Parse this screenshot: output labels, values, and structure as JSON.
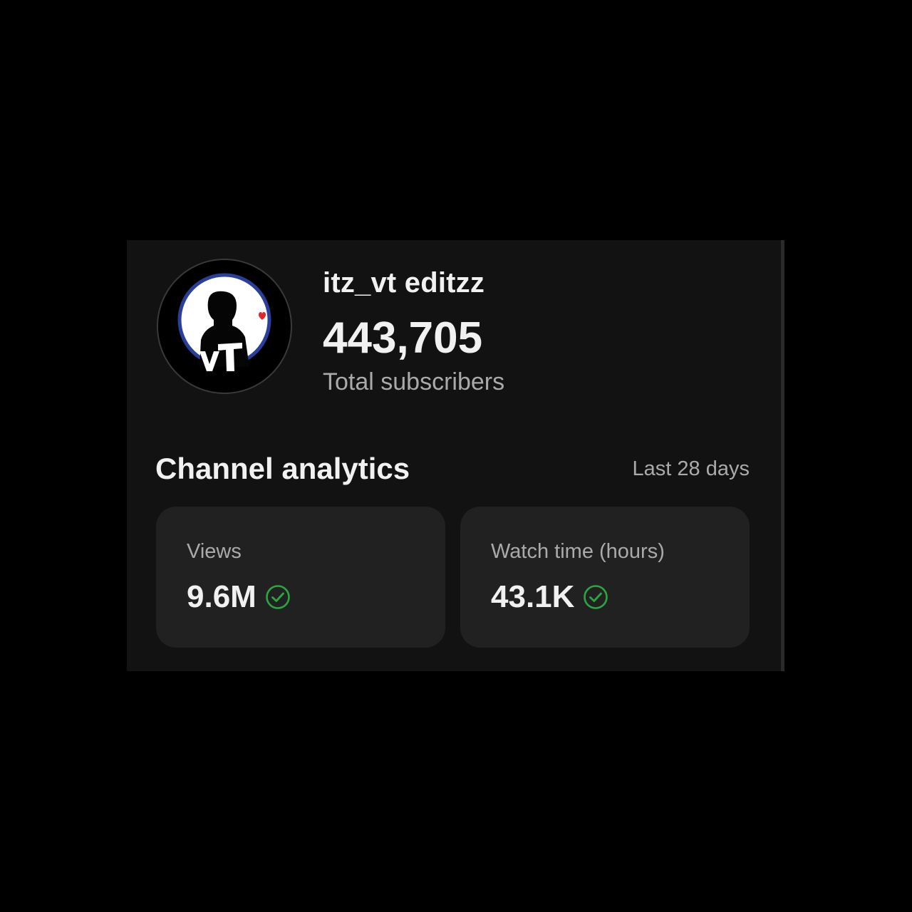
{
  "channel": {
    "name": "itz_vt editzz",
    "subscriber_count": "443,705",
    "subscriber_label": "Total subscribers",
    "avatar_icon": "silhouette-logo-avatar"
  },
  "analytics": {
    "title": "Channel analytics",
    "period": "Last 28 days",
    "metrics": [
      {
        "label": "Views",
        "value": "9.6M",
        "status_icon": "check-circle-icon"
      },
      {
        "label": "Watch time (hours)",
        "value": "43.1K",
        "status_icon": "check-circle-icon"
      }
    ]
  },
  "colors": {
    "background": "#000000",
    "card": "#121212",
    "metric_card": "#212121",
    "primary_text": "#f1f1f1",
    "secondary_text": "#aaaaaa",
    "success_green": "#2ba640"
  }
}
